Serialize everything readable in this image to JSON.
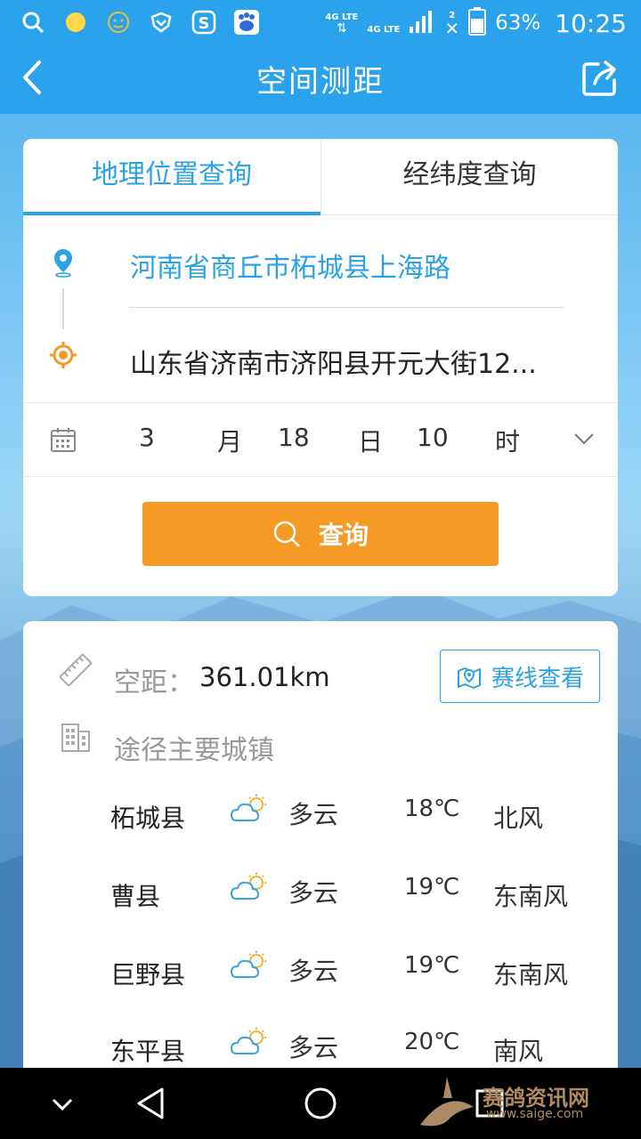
{
  "status_bar": {
    "net_top": "4G LTE",
    "net_bottom": "4G LTE",
    "sim_label": "2",
    "battery": "63%",
    "time": "10:25"
  },
  "header": {
    "title": "空间测距"
  },
  "tabs": [
    {
      "label": "地理位置查询"
    },
    {
      "label": "经纬度查询"
    }
  ],
  "origin": "河南省商丘市柘城县上海路",
  "destination": "山东省济南市济阳县开元大街12...",
  "date": {
    "month_value": "3",
    "month_unit": "月",
    "day_value": "18",
    "day_unit": "日",
    "hour_value": "10",
    "hour_unit": "时"
  },
  "query_button": "查询",
  "result": {
    "distance_label": "空距：",
    "distance_value": "361.01km",
    "route_button": "赛线查看",
    "via_label": "途径主要城镇",
    "towns": [
      {
        "city": "柘城县",
        "weather": "多云",
        "temp": "18℃",
        "wind": "北风"
      },
      {
        "city": "曹县",
        "weather": "多云",
        "temp": "19℃",
        "wind": "东南风"
      },
      {
        "city": "巨野县",
        "weather": "多云",
        "temp": "19℃",
        "wind": "东南风"
      },
      {
        "city": "东平县",
        "weather": "多云",
        "temp": "20℃",
        "wind": "南风"
      }
    ]
  },
  "watermark": {
    "text": "赛鸽资讯网",
    "url": "www.saige.com"
  },
  "colors": {
    "accent": "#2ba2e6",
    "button": "#f49a25",
    "header": "#2aa2ec"
  }
}
